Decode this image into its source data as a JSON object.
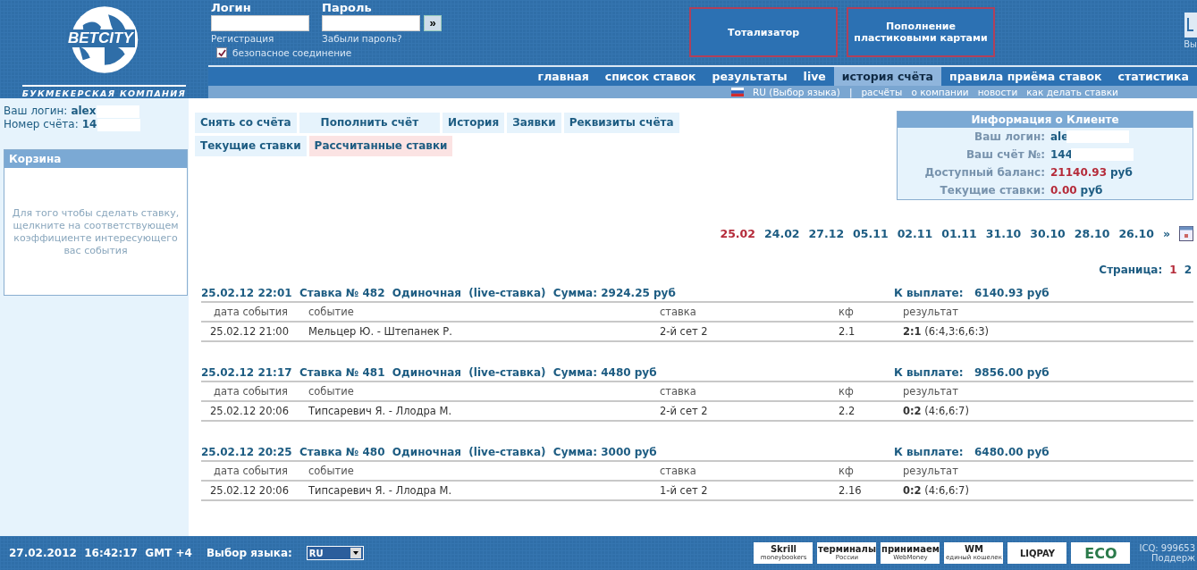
{
  "logo": {
    "name": "BETCITY",
    "tagline": "БУКМЕКЕРСКАЯ КОМПАНИЯ"
  },
  "login": {
    "login_label": "Логин",
    "password_label": "Пароль",
    "submit": "»",
    "register_link": "Регистрация",
    "forgot_link": "Забыли пароль?",
    "secure": {
      "label": "безопасное соединение",
      "checked": true
    }
  },
  "promo_buttons": [
    "Тотализатор",
    "Пополнение пластиковыми картами"
  ],
  "exit_label": "Вы",
  "nav": [
    {
      "label": "главная",
      "selected": false
    },
    {
      "label": "список ставок",
      "selected": false
    },
    {
      "label": "результаты",
      "selected": false
    },
    {
      "label": "live",
      "selected": false
    },
    {
      "label": "история счёта",
      "selected": true
    },
    {
      "label": "правила приёма ставок",
      "selected": false
    },
    {
      "label": "статистика",
      "selected": false
    }
  ],
  "subnav": {
    "language": "RU (Выбор языка)",
    "separator": "|",
    "links": [
      "расчёты",
      "о компании",
      "новости",
      "как делать ставки"
    ]
  },
  "sidebar": {
    "login_label": "Ваш логин:",
    "login_value": "alex",
    "account_label": "Номер счёта:",
    "account_value": "14",
    "basket_title": "Корзина",
    "basket_hint": "Для того чтобы сделать ставку, щелкните на соответствующем коэффициенте интересующего вас события"
  },
  "account_tabs": [
    [
      {
        "label": "Снять со счёта",
        "selected": false
      },
      {
        "label": "Пополнить счёт",
        "selected": false
      },
      {
        "label": "История",
        "selected": false
      },
      {
        "label": "Заявки",
        "selected": false
      },
      {
        "label": "Реквизиты счёта",
        "selected": false
      }
    ],
    [
      {
        "label": "Текущие ставки",
        "selected": false
      },
      {
        "label": "Рассчитанные ставки",
        "selected": true
      }
    ]
  ],
  "client_info": {
    "title": "Информация о Клиенте",
    "rows": [
      {
        "label": "Ваш логин:",
        "value": "ale",
        "unit": "",
        "kind": "masked"
      },
      {
        "label": "Ваш счёт №:",
        "value": "144",
        "unit": "",
        "kind": "masked"
      },
      {
        "label": "Доступный баланс:",
        "value": "21140.93",
        "unit": "руб",
        "kind": "money"
      },
      {
        "label": "Текущие ставки:",
        "value": "0.00",
        "unit": "руб",
        "kind": "money"
      }
    ]
  },
  "dates": [
    {
      "label": "25.02",
      "selected": true
    },
    {
      "label": "24.02",
      "selected": false
    },
    {
      "label": "27.12",
      "selected": false
    },
    {
      "label": "05.11",
      "selected": false
    },
    {
      "label": "02.11",
      "selected": false
    },
    {
      "label": "01.11",
      "selected": false
    },
    {
      "label": "31.10",
      "selected": false
    },
    {
      "label": "30.10",
      "selected": false
    },
    {
      "label": "28.10",
      "selected": false
    },
    {
      "label": "26.10",
      "selected": false
    }
  ],
  "dates_more": "»",
  "pages": {
    "label": "Страница:",
    "items": [
      {
        "label": "1",
        "selected": true
      },
      {
        "label": "2",
        "selected": false
      }
    ]
  },
  "bets": [
    {
      "title": "25.02.12 22:01  Ставка № 482  Одиночная  (live-ставка)  Сумма: 2924.25 руб",
      "payout_label": "К выплате:",
      "payout": "6140.93 руб",
      "columns": [
        "дата события",
        "событие",
        "ставка",
        "кф",
        "результат"
      ],
      "row": {
        "date": "25.02.12 21:00",
        "event": "Мельцер Ю. - Штепанек Р.",
        "stake": "2-й сет 2",
        "odds": "2.1",
        "result": "**2:1** (6:4,3:6,6:3)"
      }
    },
    {
      "title": "25.02.12 21:17  Ставка № 481  Одиночная  (live-ставка)  Сумма: 4480 руб",
      "payout_label": "К выплате:",
      "payout": "9856.00 руб",
      "columns": [
        "дата события",
        "событие",
        "ставка",
        "кф",
        "результат"
      ],
      "row": {
        "date": "25.02.12 20:06",
        "event": "Типсаревич Я. - Ллодра М.",
        "stake": "2-й сет 2",
        "odds": "2.2",
        "result": "**0:2** (4:6,6:7)"
      }
    },
    {
      "title": "25.02.12 20:25  Ставка № 480  Одиночная  (live-ставка)  Сумма: 3000 руб",
      "payout_label": "К выплате:",
      "payout": "6480.00 руб",
      "columns": [
        "дата события",
        "событие",
        "ставка",
        "кф",
        "результат"
      ],
      "row": {
        "date": "25.02.12 20:06",
        "event": "Типсаревич Я. - Ллодра М.",
        "stake": "1-й сет 2",
        "odds": "2.16",
        "result": "**0:2** (4:6,6:7)"
      }
    }
  ],
  "footer": {
    "datetime": "27.02.2012  16:42:17  GMT +4",
    "language_label": "Выбор языка:",
    "language_value": "RU",
    "payment_logos": [
      [
        "Skrill",
        "moneybookers"
      ],
      [
        "терминалы",
        "России"
      ],
      [
        "принимаем",
        "WebMoney"
      ],
      [
        "WM",
        "единый кошелек"
      ],
      [
        "LIQPAY"
      ],
      [
        "ECO"
      ]
    ],
    "icq": "ICQ: 999653",
    "support": "Поддерж"
  }
}
